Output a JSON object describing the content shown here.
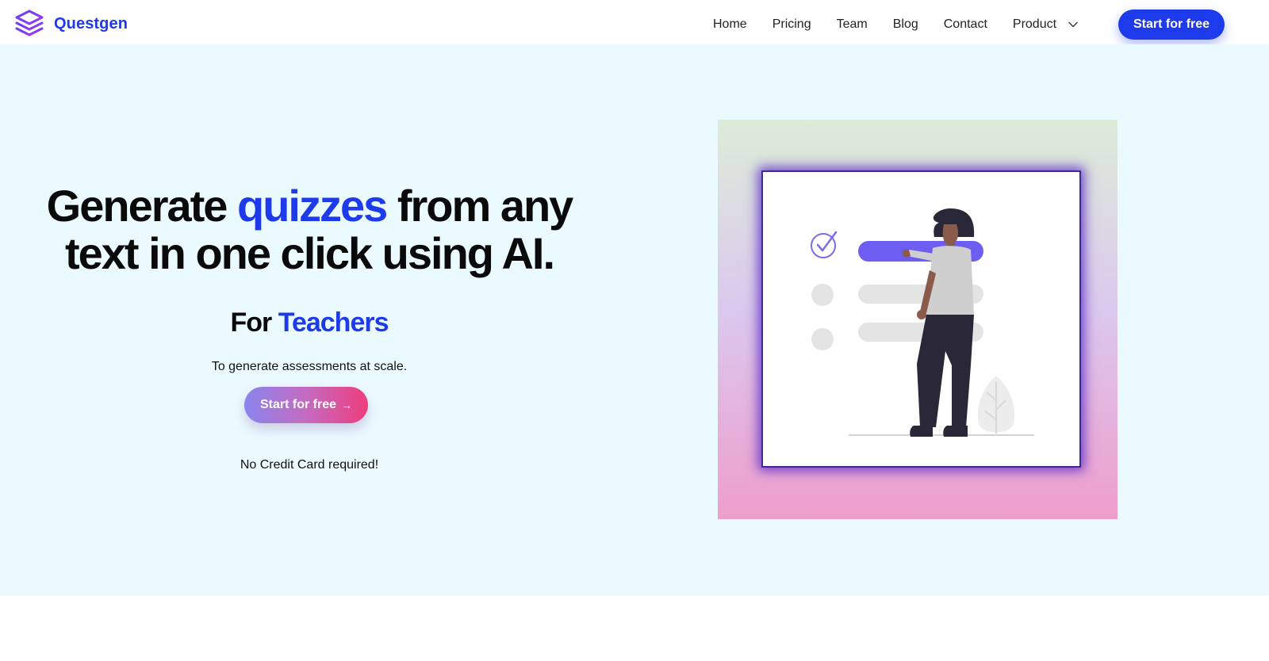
{
  "brand": {
    "name": "Questgen",
    "icon": "stacked-layers-icon",
    "color": "#1d3bea"
  },
  "nav": {
    "items": [
      "Home",
      "Pricing",
      "Team",
      "Blog",
      "Contact"
    ],
    "product_label": "Product",
    "cta_label": "Start for free"
  },
  "hero": {
    "headline_part1": "Generate ",
    "headline_accent": "quizzes",
    "headline_part2": " from any text in one click using AI.",
    "sub_prefix": "For ",
    "sub_accent": "Teachers",
    "tagline": "To generate assessments at scale.",
    "cta_label": "Start for free",
    "cta_arrow": "→",
    "note": "No Credit Card required!"
  },
  "colors": {
    "accent": "#1d3bea",
    "hero_bg": "#eafaff",
    "cta_gradient_start": "#8a84ee",
    "cta_gradient_end": "#ee3d7c"
  },
  "illustration": {
    "subject": "person-with-checklist-illustration"
  }
}
